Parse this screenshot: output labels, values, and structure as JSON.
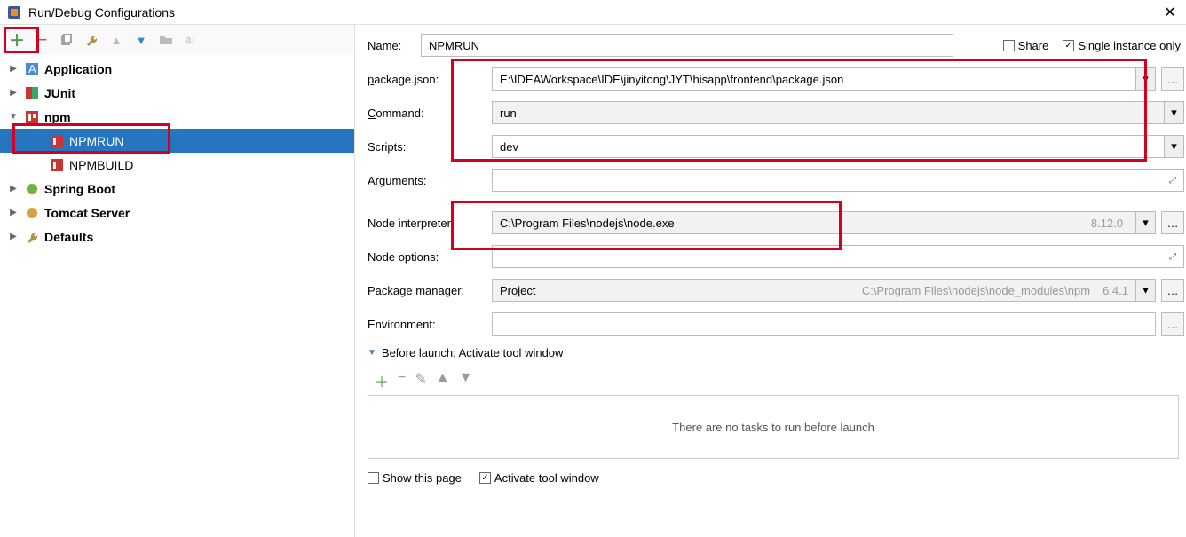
{
  "title": "Run/Debug Configurations",
  "tree": {
    "application": "Application",
    "junit": "JUnit",
    "npm": "npm",
    "npmrun": "NPMRUN",
    "npmbuild": "NPMBUILD",
    "springboot": "Spring Boot",
    "tomcat": "Tomcat Server",
    "defaults": "Defaults"
  },
  "form": {
    "name_label_pre": "N",
    "name_label_post": "ame:",
    "name": "NPMRUN",
    "share": "Share",
    "single_instance": "Single instance only",
    "package_label_pre": "p",
    "package_label_post": "ackage.json:",
    "package": "E:\\IDEAWorkspace\\IDE\\jinyitong\\JYT\\hisapp\\frontend\\package.json",
    "command_label_pre": "C",
    "command_label_post": "ommand:",
    "command": "run",
    "scripts_label": "Scripts:",
    "scripts": "dev",
    "arguments_label": "Arguments:",
    "arguments": "",
    "node_interp_label": "Node interpreter:",
    "node_interp": "C:\\Program Files\\nodejs\\node.exe",
    "node_interp_version": "8.12.0",
    "node_options_label": "Node options:",
    "node_options": "",
    "pkg_manager_label_pre": "Package ",
    "pkg_manager_label_u": "m",
    "pkg_manager_label_post": "anager:",
    "pkg_manager": "Project",
    "pkg_manager_hint": "C:\\Program Files\\nodejs\\node_modules\\npm",
    "pkg_manager_version": "6.4.1",
    "env_label": "Environment:",
    "env": "",
    "before_launch_pre": "B",
    "before_launch_post": "efore launch: Activate tool window",
    "before_empty": "There are no tasks to run before launch",
    "show_page": "Show this page",
    "activate_tool": "Activate tool window"
  }
}
